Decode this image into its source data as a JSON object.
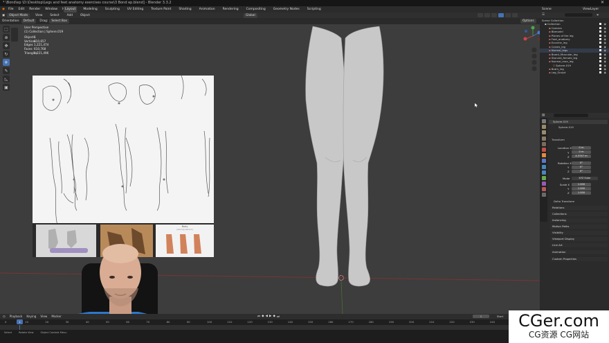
{
  "app": {
    "title": "* \\Bond\\ep \\D:\\Desktop\\Legs and feet anatomy exercises course\\3 Bond ep.blend] - Blender 3.3.2",
    "close_icon": "close-icon"
  },
  "menubar": {
    "items": [
      "File",
      "Edit",
      "Render",
      "Window",
      "Help"
    ],
    "workspaces": [
      "Layout",
      "Modeling",
      "Sculpting",
      "UV Editing",
      "Texture Paint",
      "Shading",
      "Animation",
      "Rendering",
      "Compositing",
      "Geometry Nodes",
      "Scripting"
    ],
    "active_workspace": "Layout",
    "scene": "Scene",
    "view_layer": "ViewLayer"
  },
  "header": {
    "mode": "Object Mode",
    "menus": [
      "View",
      "Select",
      "Add",
      "Object"
    ],
    "transform_orientation": "Global",
    "options": "Options"
  },
  "tool_settings": {
    "orientation_label": "Orientation:",
    "orientation": "Default",
    "drag_label": "Drag:",
    "drag": "Select Box"
  },
  "viewport": {
    "view_name": "User Perspective",
    "collection_line": "(1) Collection | Sphere.019",
    "stats": [
      {
        "label": "Objects",
        "value": "1"
      },
      {
        "label": "Vertices",
        "value": "610,657"
      },
      {
        "label": "Edges",
        "value": "1,221,474"
      },
      {
        "label": "Faces",
        "value": "610,768"
      },
      {
        "label": "Triangles",
        "value": "1,221,496"
      }
    ]
  },
  "ref_panel": {
    "thumb_title": "Body",
    "thumb_subtitle": "(aerodynamics)"
  },
  "outliner": {
    "title": "Scene Collection",
    "items": [
      {
        "label": "Collection",
        "depth": 0,
        "color": "#e0e0e0"
      },
      {
        "label": "Camera",
        "depth": 1,
        "color": "#c89a5c"
      },
      {
        "label": "Bbmodel",
        "depth": 1,
        "color": "#d36e6e"
      },
      {
        "label": "Planes of the leg",
        "depth": 1,
        "color": "#d36e6e"
      },
      {
        "label": "Foot_anatomy",
        "depth": 1,
        "color": "#d36e6e"
      },
      {
        "label": "Ecorche_leg",
        "depth": 1,
        "color": "#d36e6e"
      },
      {
        "label": "Calves_leg",
        "depth": 1,
        "color": "#d36e6e"
      },
      {
        "label": "Normal_legs",
        "depth": 1,
        "color": "#d36e6e"
      },
      {
        "label": "Board_Muscular_leg",
        "depth": 1,
        "color": "#d36e6e"
      },
      {
        "label": "Starved_female_leg",
        "depth": 1,
        "color": "#d36e6e"
      },
      {
        "label": "Normal_man_leg",
        "depth": 1,
        "color": "#d36e6e"
      },
      {
        "label": "Sphere.019",
        "depth": 2,
        "color": "#e0a060"
      },
      {
        "label": "Bob's_leg",
        "depth": 1,
        "color": "#d36e6e"
      },
      {
        "label": "Leg_Sculpt",
        "depth": 1,
        "color": "#d36e6e"
      }
    ]
  },
  "properties": {
    "object_name": "Sphere.019",
    "data_name": "Sphere.019",
    "transform_title": "Transform",
    "location_label": "Location X",
    "loc": [
      "0 m",
      "0 m",
      "4.3747 m"
    ],
    "rotation_label": "Rotation X",
    "rot": [
      "0°",
      "0°",
      "0°"
    ],
    "mode_label": "Mode",
    "mode": "XYZ Euler",
    "scale_label": "Scale X",
    "scale": [
      "1.000",
      "1.000",
      "1.000"
    ],
    "axes": [
      "X",
      "Y",
      "Z"
    ],
    "delta": "Delta Transform",
    "sections": [
      "Relations",
      "Collections",
      "Instancing",
      "Motion Paths",
      "Visibility",
      "Viewport Display",
      "Line Art",
      "Animation",
      "Custom Properties"
    ]
  },
  "timeline": {
    "menus": [
      "Playback",
      "Keying",
      "View",
      "Marker"
    ],
    "current_frame": "1",
    "start_label": "Start",
    "end_label": "End",
    "start": "1",
    "end": "250",
    "ticks": [
      "0",
      "10",
      "20",
      "30",
      "40",
      "50",
      "60",
      "70",
      "80",
      "90",
      "100",
      "110",
      "120",
      "130",
      "140",
      "150",
      "160",
      "170",
      "180",
      "190",
      "200",
      "210",
      "220",
      "230",
      "240"
    ]
  },
  "status": {
    "left": "Select",
    "middle": "Rotate View",
    "right": "Object Context Menu"
  },
  "watermark": {
    "title": "CGer.com",
    "subtitle": "CG资源 CG网站"
  }
}
